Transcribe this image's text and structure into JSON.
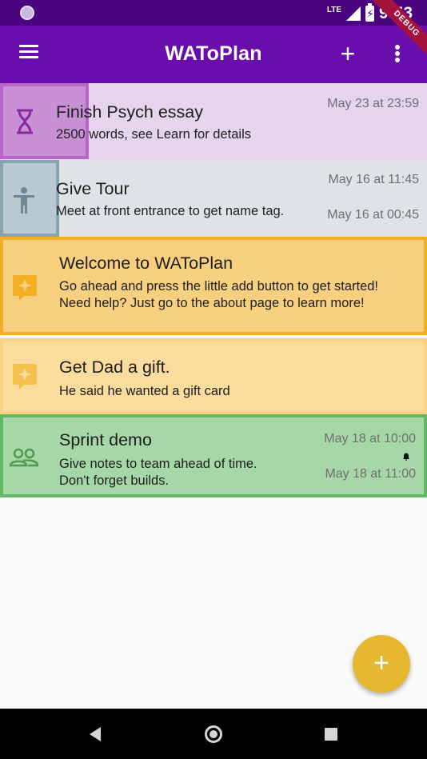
{
  "status_bar": {
    "network": "LTE",
    "battery_bolt": "⚡",
    "time": "9:53"
  },
  "app_bar": {
    "title": "WAToPlan",
    "add_label": "+",
    "debug_ribbon": "DEBUG"
  },
  "tasks": [
    {
      "icon": "hourglass-icon",
      "title": "Finish Psych essay",
      "description": "2500 words, see Learn for details",
      "dates": [
        "May 23 at 23:59"
      ],
      "colors": {
        "background": "#e6d3ec",
        "accent": "#b864c8"
      }
    },
    {
      "icon": "person-icon",
      "title": "Give Tour",
      "description": "Meet at front entrance to get name tag.",
      "dates": [
        "May 16 at 11:45",
        "May 16 at 00:45"
      ],
      "colors": {
        "background": "#dfe3e6",
        "accent": "#8aa3b0"
      }
    },
    {
      "icon": "sparkle-icon",
      "title": "Welcome to WAToPlan",
      "description": "Go ahead and press the little add button to get started! Need help? Just go to the about page to learn more!",
      "dates": [],
      "colors": {
        "background": "#f6cf7f",
        "accent": "#f4ae24"
      }
    },
    {
      "icon": "sparkle-icon",
      "title": "Get Dad a gift.",
      "description": "He said he wanted a gift card",
      "dates": [],
      "colors": {
        "background": "#fadc9c",
        "accent": "#fbd285"
      }
    },
    {
      "icon": "people-icon",
      "title": "Sprint demo",
      "description": "Give notes to team ahead of time.\nDon't forget builds.",
      "dates": [
        "May 18 at 10:00",
        "May 18 at 11:00"
      ],
      "has_alarm": true,
      "colors": {
        "background": "#a5d8a6",
        "accent": "#63b865"
      }
    }
  ],
  "fab": {
    "label": "+",
    "color": "#e6b82f"
  },
  "colors": {
    "status_bar": "#4a0480",
    "app_bar": "#6a0dad"
  }
}
